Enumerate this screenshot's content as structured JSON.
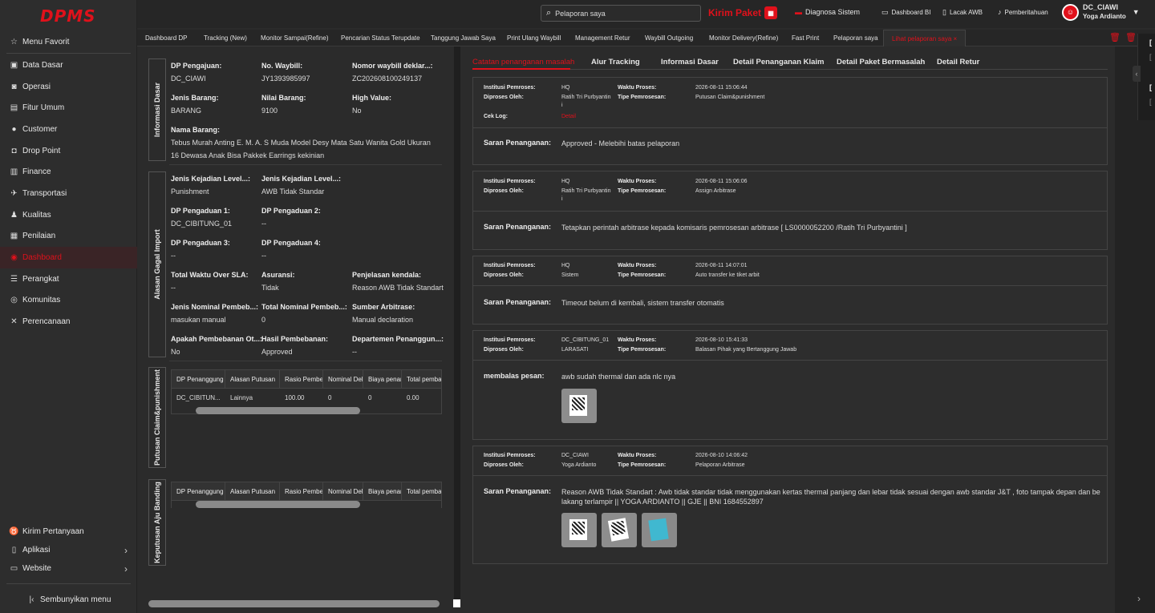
{
  "app": {
    "logo": "DPMS"
  },
  "sidebar": {
    "items": [
      {
        "label": "Menu Favorit",
        "icon": "star-icon"
      },
      {
        "label": "Data Dasar",
        "icon": "database-icon"
      },
      {
        "label": "Operasi",
        "icon": "operation-icon"
      },
      {
        "label": "Fitur Umum",
        "icon": "briefcase-icon"
      },
      {
        "label": "Customer",
        "icon": "user-icon"
      },
      {
        "label": "Drop Point",
        "icon": "droppoint-icon"
      },
      {
        "label": "Finance",
        "icon": "finance-icon"
      },
      {
        "label": "Transportasi",
        "icon": "transport-icon"
      },
      {
        "label": "Kualitas",
        "icon": "quality-icon"
      },
      {
        "label": "Penilaian",
        "icon": "evaluation-icon"
      },
      {
        "label": "Dashboard",
        "icon": "dashboard-icon"
      },
      {
        "label": "Perangkat",
        "icon": "device-icon"
      },
      {
        "label": "Komunitas",
        "icon": "community-icon"
      },
      {
        "label": "Perencanaan",
        "icon": "planning-icon"
      }
    ],
    "bottom": [
      {
        "label": "Kirim Pertanyaan",
        "icon": "question-icon"
      },
      {
        "label": "Aplikasi",
        "icon": "app-icon"
      },
      {
        "label": "Website",
        "icon": "website-icon"
      }
    ],
    "hide_label": "Sembunyikan menu"
  },
  "topbar": {
    "search_placeholder": "Pelaporan saya",
    "kirim_paket": "Kirim Paket",
    "diagnosa": "Diagnosa Sistem",
    "dashboard_bi": "Dashboard BI",
    "lacak_awb": "Lacak AWB",
    "pemberitahuan": "Pemberitahuan",
    "user_code": "DC_CIAWI",
    "user_name": "Yoga Ardianto"
  },
  "tabs": [
    "Dashboard DP",
    "Tracking (New)",
    "Monitor Sampai(Refine)",
    "Pencarian Status Terupdate",
    "Tanggung Jawab Saya",
    "Print Ulang Waybill",
    "Management Retur",
    "Waybill Outgoing",
    "Monitor Delivery(Refine)",
    "Fast Print",
    "Pelaporan saya",
    "Lihat pelaporan saya"
  ],
  "left": {
    "sections": {
      "informasi_dasar": "Informasi Dasar",
      "alasan_gagal": "Alasan Gagal Import",
      "putusan": "Putusan Claim&punishment",
      "keputusan": "Keputusan Aju Banding"
    },
    "info": {
      "dp_pengajuan_label": "DP Pengajuan:",
      "dp_pengajuan": "DC_CIAWI",
      "no_waybill_label": "No. Waybill:",
      "no_waybill": "JY1393985997",
      "nomor_dekl_label": "Nomor waybill deklar...:",
      "nomor_dekl": "ZC202608100249137",
      "jenis_barang_label": "Jenis Barang:",
      "jenis_barang": "BARANG",
      "nilai_barang_label": "Nilai Barang:",
      "nilai_barang": "9100",
      "high_value_label": "High Value:",
      "high_value": "No",
      "nama_barang_label": "Nama Barang:",
      "nama_barang_1": "Tebus Murah Anting E. M. A. S Muda Model Desy Mata Satu Wanita Gold Ukuran",
      "nama_barang_2": "16 Dewasa Anak Bisa Pakkek Earrings kekinian"
    },
    "alasan": {
      "jk1_label": "Jenis Kejadian Level...:",
      "jk1": "Punishment",
      "jk2_label": "Jenis Kejadian Level...:",
      "jk2": "AWB Tidak Standar",
      "dp1_label": "DP Pengaduan 1:",
      "dp1": "DC_CIBITUNG_01",
      "dp2_label": "DP Pengaduan 2:",
      "dp2": "--",
      "dp3_label": "DP Pengaduan 3:",
      "dp3": "--",
      "dp4_label": "DP Pengaduan 4:",
      "dp4": "--",
      "tw_label": "Total Waktu Over SLA:",
      "tw": "--",
      "as_label": "Asuransi:",
      "as": "Tidak",
      "pk_label": "Penjelasan kendala:",
      "pk": "Reason AWB Tidak Standart",
      "jn_label": "Jenis Nominal Pembeb...:",
      "jn": "masukan manual",
      "tn_label": "Total Nominal Pembeb...:",
      "tn": "0",
      "sa_label": "Sumber Arbitrase:",
      "sa": "Manual declaration",
      "ap_label": "Apakah Pembebanan Ot...:",
      "ap": "No",
      "hp_label": "Hasil Pembebanan:",
      "hp": "Approved",
      "dpg_label": "Departemen Penanggun...:",
      "dpg": "--"
    },
    "table_headers": [
      "DP Penanggung ...",
      "Alasan Putusan",
      "Rasio Pembeb",
      "Nominal Deb",
      "Biaya penan",
      "Total pemba"
    ],
    "putusan_row": [
      "DC_CIBITUN...",
      "Lainnya",
      "100.00",
      "0",
      "0",
      "0.00"
    ]
  },
  "right": {
    "tabs": [
      "Catatan penanganan masalah",
      "Alur Tracking",
      "Informasi Dasar",
      "Detail Penanganan Klaim",
      "Detail Paket Bermasalah",
      "Detail Retur"
    ],
    "labels": {
      "institusi": "Institusi Pemroses:",
      "diproses": "Diproses Oleh:",
      "waktu": "Waktu Proses:",
      "tipe": "Tipe Pemrosesan:",
      "ceklog": "Cek Log:",
      "detail": "Detail",
      "saran": "Saran Penanganan:",
      "membalas": "membalas pesan:"
    },
    "records": [
      {
        "institusi": "HQ",
        "diproses": "Ratih Tri Purbyantin",
        "diproses2": "i",
        "waktu": "2026-08-11 15:06:44",
        "tipe": "Putusan Claim&punishment",
        "saran": "Approved - Melebihi batas pelaporan"
      },
      {
        "institusi": "HQ",
        "diproses": "Ratih Tri Purbyantin",
        "diproses2": "i",
        "waktu": "2026-08-11 15:06:06",
        "tipe": "Assign Arbitrase",
        "saran": "Tetapkan perintah arbitrase kepada komisaris pemrosesan arbitrase [ LS0000052200 /Ratih Tri Purbyantini ]"
      },
      {
        "institusi": "HQ",
        "diproses": "Sistem",
        "waktu": "2026-08-11 14:07:01",
        "tipe": "Auto transfer ke tiket arbit",
        "saran": "Timeout belum di kembali, sistem transfer otomatis"
      },
      {
        "institusi": "DC_CIBITUNG_01",
        "diproses": "LARASATI",
        "waktu": "2026-08-10 15:41:33",
        "tipe": "Balasan Pihak yang Bertanggung Jawab",
        "saran": "awb sudah thermal dan ada nlc nya"
      },
      {
        "institusi": "DC_CIAWI",
        "diproses": "Yoga Ardianto",
        "waktu": "2026-08-10 14:06:42",
        "tipe": "Pelaporan Arbitrase",
        "saran": "Reason AWB Tidak Standart : Awb tidak standar tidak menggunakan kertas thermal panjang dan lebar tidak sesuai dengan awb standar J&T , foto tampak depan dan belakang terlampir || YOGA ARDIANTO || GJE || BNI 1684552897"
      }
    ]
  },
  "colors": {
    "accent": "#e0111b",
    "bg": "#2b2b2b"
  }
}
